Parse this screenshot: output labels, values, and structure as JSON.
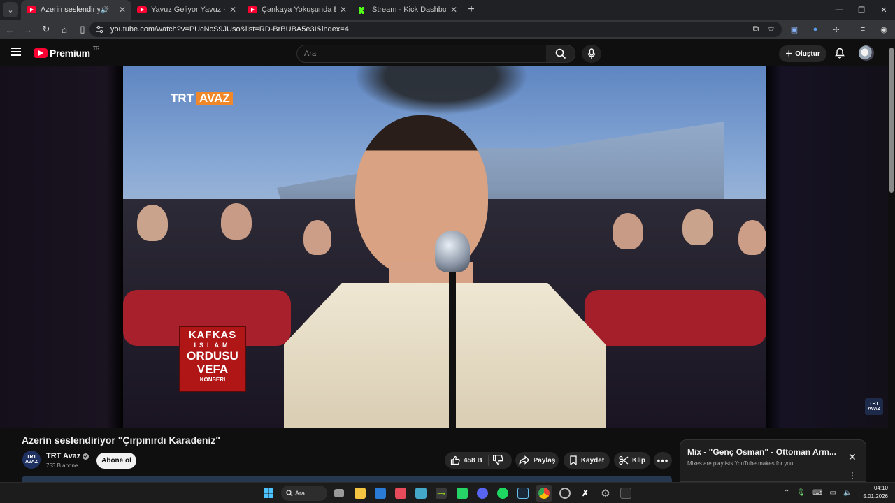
{
  "browser": {
    "tabs": [
      {
        "title": "Azerin seslendiriyor \"Çırpı",
        "favicon": "youtube-icon",
        "active": true,
        "audio": true
      },
      {
        "title": "Yavuz Geliyor Yavuz - TSK Arm",
        "favicon": "youtube-icon",
        "active": false
      },
      {
        "title": "Çankaya Yokuşunda Bozkurtla",
        "favicon": "youtube-icon",
        "active": false
      },
      {
        "title": "Stream - Kick Dashboard",
        "favicon": "kick-icon",
        "active": false
      }
    ],
    "url": "youtube.com/watch?v=PUcNcS9JUso&list=RD-BrBUBA5e3I&index=4"
  },
  "youtube": {
    "logo_text": "Premium",
    "country_code": "TR",
    "search_placeholder": "Ara",
    "create_label": "Oluştur"
  },
  "video": {
    "overlay_logo": {
      "part1": "TRT",
      "part2": "AVAZ"
    },
    "concert_badge": [
      "KAFKAS",
      "İSLAM",
      "ORDUSU",
      "VEFA",
      "KONSERİ"
    ],
    "corner_logo": "TRT AVAZ"
  },
  "details": {
    "title": "Azerin seslendiriyor \"Çırpınırdı Karadeniz\"",
    "channel": {
      "avatar_text": "TRT AVAZ",
      "name": "TRT Avaz",
      "subs": "753 B abone",
      "verified": true
    },
    "subscribe_label": "Abone ol",
    "actions": {
      "likes": "458 B",
      "share": "Paylaş",
      "save": "Kaydet",
      "clip": "Klip"
    }
  },
  "mix": {
    "title": "Mix - \"Genç Osman\" - Ottoman Arm...",
    "subtitle": "Mixes are playlists YouTube makes for you"
  },
  "taskbar": {
    "search_label": "Ara",
    "time": "04:10",
    "date": "5.01.2026"
  },
  "colors": {
    "youtube_red": "#ff0033",
    "kick_green": "#53fc18",
    "trt_orange": "#f0882a"
  }
}
